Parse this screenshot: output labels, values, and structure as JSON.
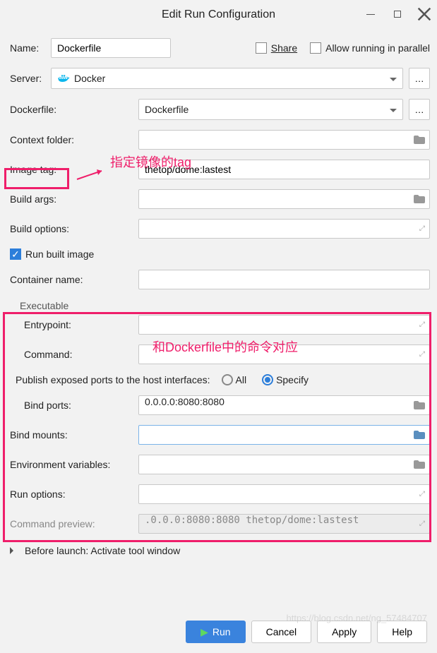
{
  "window": {
    "title": "Edit Run Configuration"
  },
  "form": {
    "name_label": "Name:",
    "name_value": "Dockerfile",
    "share_label": "Share",
    "allow_parallel_label": "Allow running in parallel",
    "server_label": "Server:",
    "server_value": "Docker",
    "dockerfile_label": "Dockerfile:",
    "dockerfile_value": "Dockerfile",
    "context_label": "Context folder:",
    "context_value": "",
    "imagetag_label": "Image tag:",
    "imagetag_value": "thetop/dome:lastest",
    "buildargs_label": "Build args:",
    "buildargs_value": "",
    "buildoptions_label": "Build options:",
    "buildoptions_value": "",
    "runbuilt_label": "Run built image",
    "container_label": "Container name:",
    "container_value": "",
    "executable_label": "Executable",
    "entrypoint_label": "Entrypoint:",
    "entrypoint_value": "",
    "command_label": "Command:",
    "command_value": "",
    "publish_label": "Publish exposed ports to the host interfaces:",
    "all_label": "All",
    "specify_label": "Specify",
    "bindports_label": "Bind ports:",
    "bindports_value": "0.0.0.0:8080:8080",
    "bindmounts_label": "Bind mounts:",
    "bindmounts_value": "",
    "env_label": "Environment variables:",
    "env_value": "",
    "runoptions_label": "Run options:",
    "runoptions_value": "",
    "preview_label": "Command preview:",
    "preview_value": ".0.0.0:8080:8080 thetop/dome:lastest",
    "before_launch_label": "Before launch: Activate tool window"
  },
  "buttons": {
    "run": "Run",
    "cancel": "Cancel",
    "apply": "Apply",
    "help": "Help"
  },
  "annotations": {
    "tag_hint": "指定镜像的tag",
    "exec_hint": "和Dockerfile中的命令对应"
  },
  "watermark": "https://blog.csdn.net/ng_57484707"
}
